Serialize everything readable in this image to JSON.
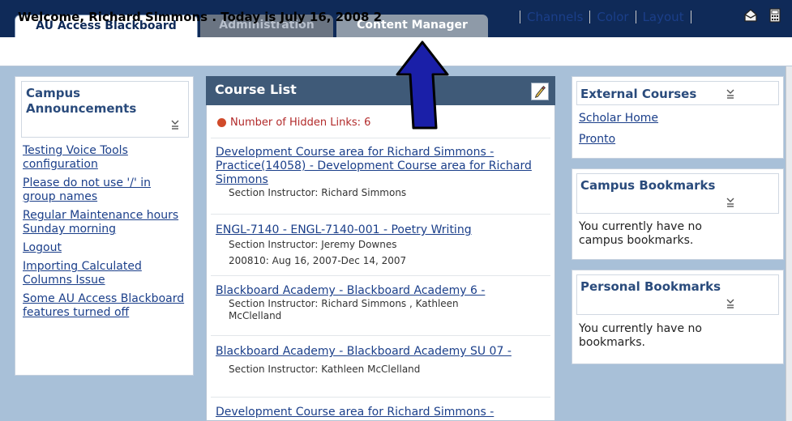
{
  "tabs": {
    "active": "AU Access Blackboard",
    "admin": "Administration",
    "content": "Content Manager"
  },
  "welcome": {
    "text": "Welcome, Richard Simmons . Today is July 16, 2008 2"
  },
  "toplinks": {
    "channels": "Channels",
    "color": "Color",
    "layout": "Layout"
  },
  "announcements": {
    "title_line1": "Campus",
    "title_line2": "Announcements",
    "items": [
      "Testing Voice Tools configuration",
      "Please do not use '/' in group names",
      "Regular Maintenance hours Sunday morning",
      "Logout",
      "Importing Calculated Columns Issue",
      "Some AU Access Blackboard features turned off"
    ]
  },
  "course_list": {
    "title": "Course List",
    "hidden_links": "Number of Hidden Links: 6",
    "courses": [
      {
        "link": "Development Course area for Richard Simmons - Practice(14058) - Development Course area for Richard Simmons",
        "instructor": "Section Instructor: Richard Simmons",
        "term": ""
      },
      {
        "link": "ENGL-7140 - ENGL-7140-001 - Poetry Writing",
        "instructor": "Section Instructor: Jeremy Downes",
        "term": "200810: Aug 16, 2007-Dec 14, 2007"
      },
      {
        "link": "Blackboard Academy - Blackboard Academy 6 -",
        "instructor": "Section Instructor: Richard Simmons , Kathleen McClelland",
        "term": ""
      },
      {
        "link": "Blackboard Academy - Blackboard Academy SU 07 -",
        "instructor": "Section Instructor: Kathleen McClelland",
        "term": ""
      },
      {
        "link": "Development Course area for Richard Simmons -",
        "instructor": "",
        "term": ""
      }
    ]
  },
  "external": {
    "title": "External Courses",
    "links": [
      "Scholar Home",
      "Pronto"
    ]
  },
  "campus_bookmarks": {
    "title": "Campus Bookmarks",
    "text": "You currently have no campus bookmarks."
  },
  "personal_bookmarks": {
    "title": "Personal Bookmarks",
    "text": "You currently have no bookmarks."
  }
}
